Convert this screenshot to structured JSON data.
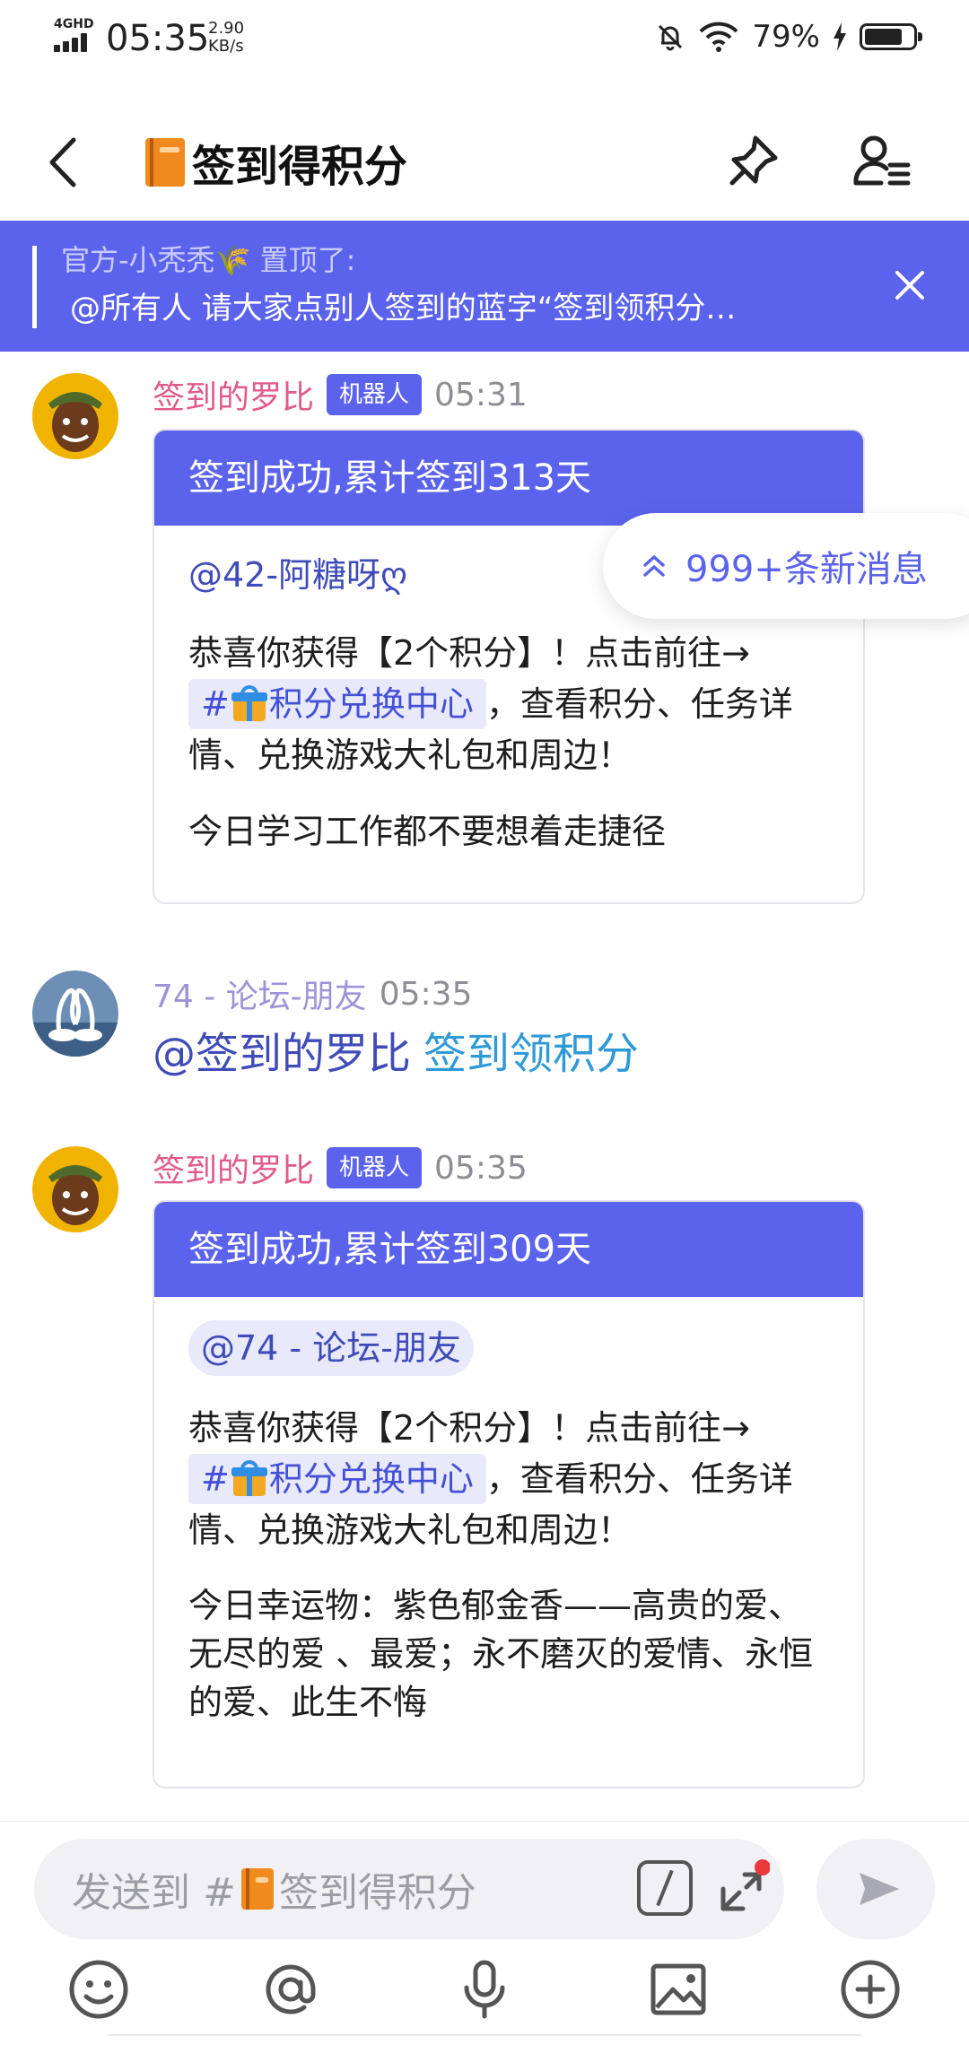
{
  "status_bar": {
    "network": "4GHD",
    "time": "05:35",
    "speed_value": "2.90",
    "speed_unit": "KB/s",
    "battery_percent": "79%",
    "battery_level": 0.79
  },
  "header": {
    "title": "签到得积分",
    "title_icon": "orange-book-icon"
  },
  "pinned": {
    "author": "官方-小秃秃🌾 置顶了:",
    "text": "@所有人 请大家点别人签到的蓝字“签到领积分…"
  },
  "new_messages": {
    "label": "999+条新消息"
  },
  "messages": [
    {
      "sender": "签到的罗比",
      "badge": "机器人",
      "time": "05:31",
      "card_title": "签到成功,累计签到313天",
      "mention": "@42-阿糖呀ღ",
      "line1_pre": "恭喜你获得【2个积分】！点击前往→",
      "channel_link": "积分兑换中心",
      "channel_hash": "#",
      "line1_post": "，查看积分、任务详情、兑换游戏大礼包和周边！",
      "extra": "今日学习工作都不要想着走捷径"
    },
    {
      "sender": "74 - 论坛-朋友",
      "time": "05:35",
      "at": "@签到的罗比",
      "link": "签到领积分"
    },
    {
      "sender": "签到的罗比",
      "badge": "机器人",
      "time": "05:35",
      "card_title": "签到成功,累计签到309天",
      "mention": "@74 - 论坛-朋友",
      "line1_pre": "恭喜你获得【2个积分】！点击前往→",
      "channel_link": "积分兑换中心",
      "channel_hash": "#",
      "line1_post": "，查看积分、任务详情、兑换游戏大礼包和周边！",
      "extra": "今日幸运物：紫色郁金香——高贵的爱、无尽的爱 、最爱；永不磨灭的爱情、永恒的爱、此生不悔"
    }
  ],
  "composer": {
    "placeholder_pre": "发送到 #",
    "placeholder_channel": "签到得积分"
  },
  "colors": {
    "accent": "#5b63ec",
    "bot_name": "#e05a8a",
    "user_name": "#9d93d8",
    "link_blue": "#2f9ad8"
  }
}
